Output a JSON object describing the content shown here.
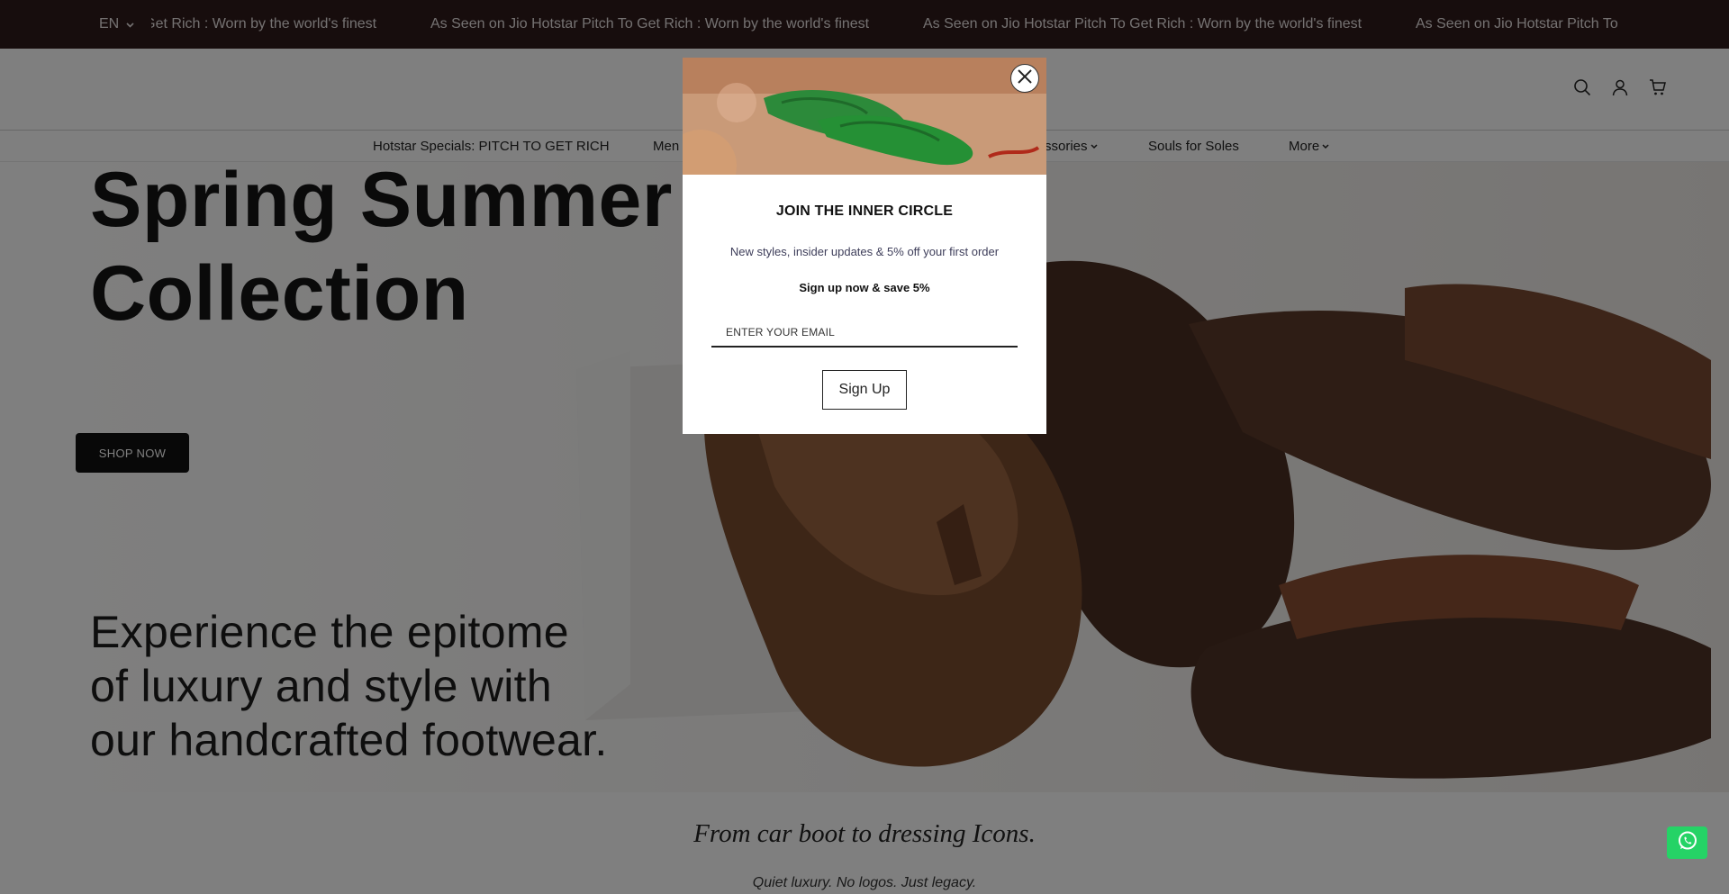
{
  "announcement": {
    "language": "EN",
    "marquee_text": "As Seen on Jio Hotstar Pitch To Get Rich : Worn by the world's finest"
  },
  "header": {
    "icons": [
      "search-icon",
      "account-icon",
      "cart-icon"
    ]
  },
  "nav": {
    "items": [
      {
        "label": "Hotstar Specials: PITCH TO GET RICH",
        "has_dropdown": false
      },
      {
        "label": "Men",
        "has_dropdown": false
      },
      {
        "label": "ssories",
        "has_dropdown": true
      },
      {
        "label": "Souls for Soles",
        "has_dropdown": false
      },
      {
        "label": "More",
        "has_dropdown": true
      }
    ]
  },
  "hero": {
    "title_line1": "Spring Summer",
    "title_line2": "Collection",
    "cta_label": "SHOP NOW",
    "subtitle_line1": "Experience the epitome",
    "subtitle_line2": "of luxury and style with",
    "subtitle_line3": "our handcrafted footwear."
  },
  "tagline": {
    "main": "From car boot to dressing Icons.",
    "sub": "Quiet luxury. No logos. Just legacy."
  },
  "modal": {
    "title": "JOIN THE INNER CIRCLE",
    "description": "New styles, insider updates & 5% off your first order",
    "highlight": "Sign up now & save 5%",
    "email_placeholder": "ENTER YOUR EMAIL",
    "email_value": "",
    "submit_label": "Sign Up"
  },
  "colors": {
    "announcement_bg": "#2e1b1b",
    "whatsapp_green": "#25d366",
    "button_dark": "#111111"
  }
}
